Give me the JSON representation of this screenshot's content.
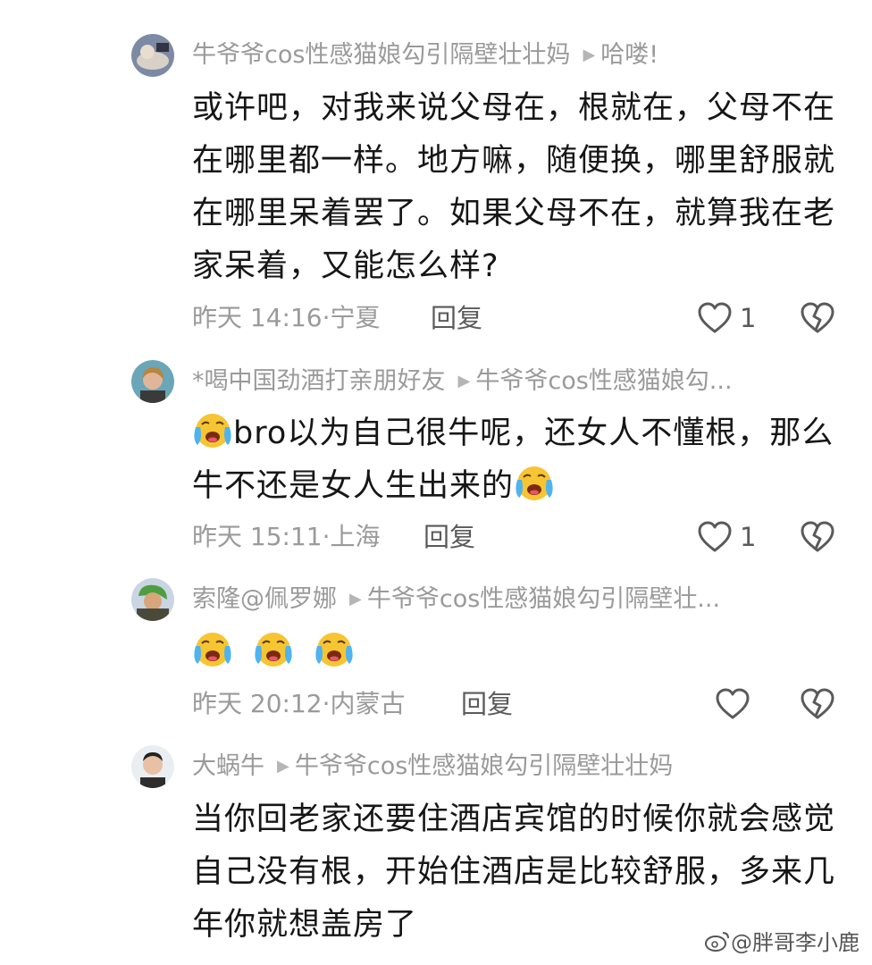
{
  "comments": [
    {
      "user": "牛爷爷cos性感猫娘勾引隔壁壮壮妈",
      "reply_to": "哈喽!",
      "lines": [
        "或许吧，对我来说父母在，根就在，父母不在",
        "在哪里都一样。地方嘛，随便换，哪里舒服就",
        "在哪里呆着罢了。如果父母不在，就算我在老",
        "家呆着，又能怎么样?"
      ],
      "time": "昨天 14:16",
      "location": "宁夏",
      "reply_label": "回复",
      "likes": "1"
    },
    {
      "user": "*喝中国劲酒打亲朋好友",
      "reply_to": "牛爷爷cos性感猫娘勾...",
      "line1_text": "bro以为自己很牛呢，还女人不懂根，那么",
      "line2_text": "牛不还是女人生出来的",
      "time": "昨天 15:11",
      "location": "上海",
      "reply_label": "回复",
      "likes": "1"
    },
    {
      "user": "索隆@佩罗娜",
      "reply_to": "牛爷爷cos性感猫娘勾引隔壁壮...",
      "time": "昨天 20:12",
      "location": "内蒙古",
      "reply_label": "回复",
      "likes": ""
    },
    {
      "user": "大蜗牛",
      "reply_to": "牛爷爷cos性感猫娘勾引隔壁壮壮妈",
      "lines": [
        "当你回老家还要住酒店宾馆的时候你就会感觉",
        "自己没有根，开始住酒店是比较舒服，多来几",
        "年你就想盖房了"
      ]
    }
  ],
  "watermark": "@胖哥李小鹿",
  "icons": [
    "heart-icon",
    "broken-heart-icon",
    "crying-emoji-icon",
    "weibo-logo-icon"
  ],
  "colors": {
    "text": "#161616",
    "meta": "#9a9a9a",
    "emoji": "#f7c531"
  }
}
